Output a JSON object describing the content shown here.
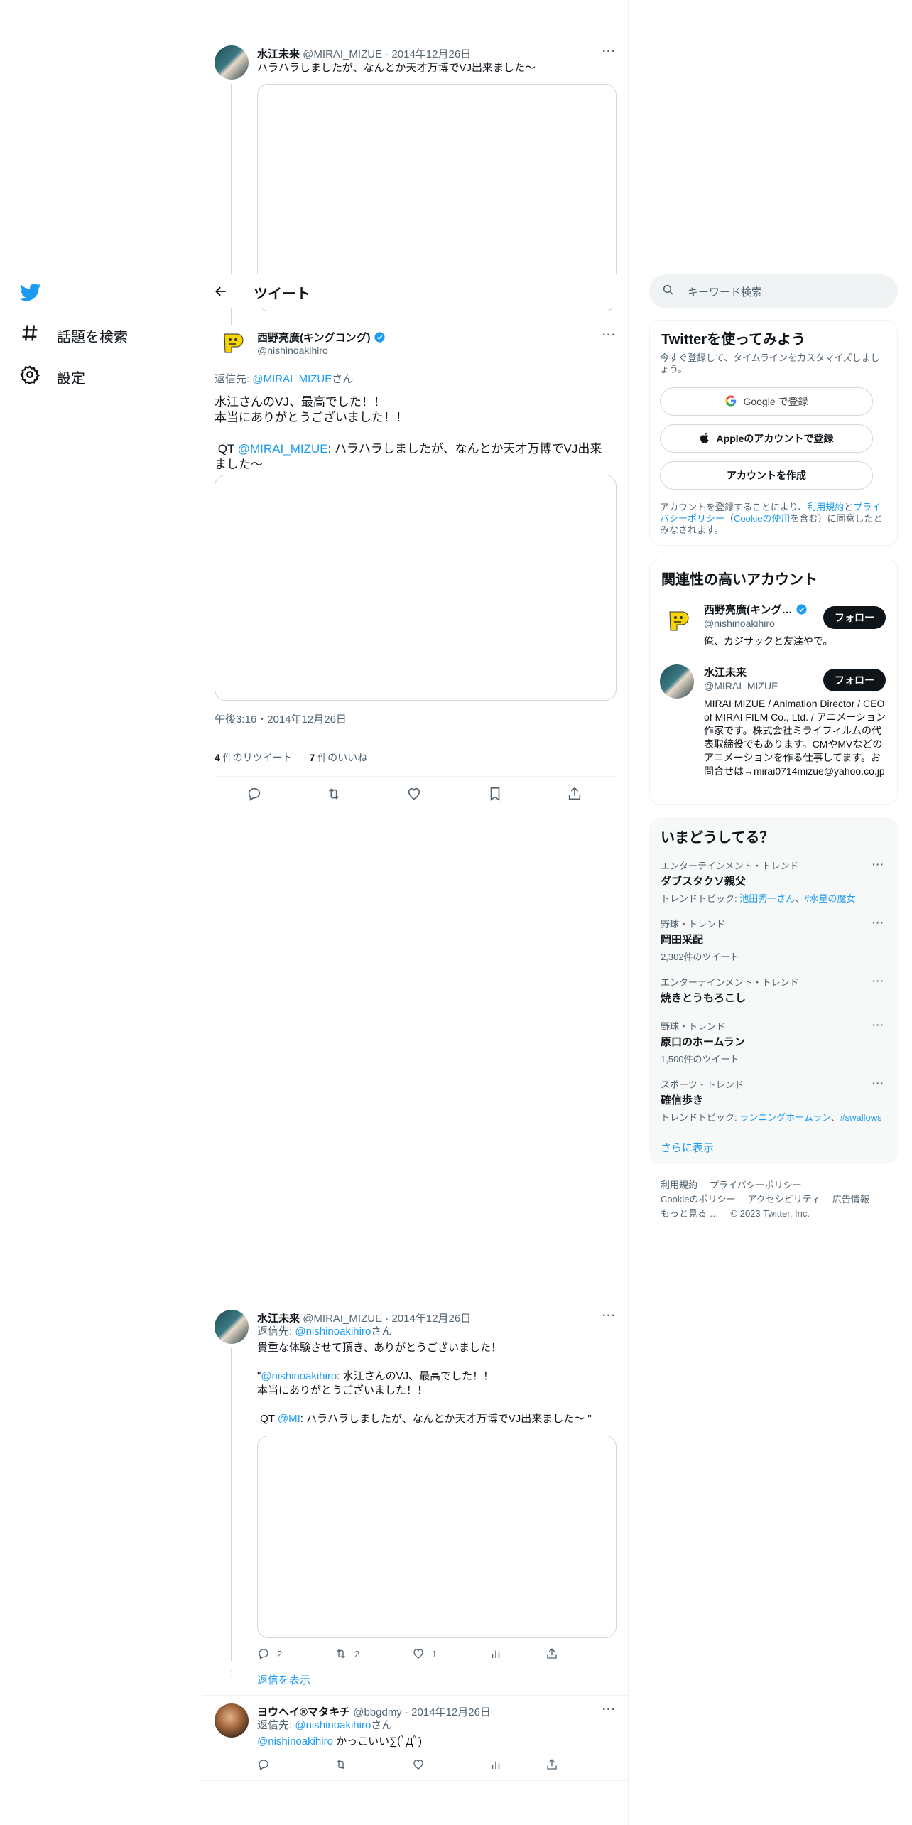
{
  "nav": {
    "items": [
      {
        "label": "話題を検索",
        "icon": "hashtag-icon"
      },
      {
        "label": "設定",
        "icon": "gear-icon"
      }
    ]
  },
  "header": {
    "title": "ツイート"
  },
  "top_tweet": {
    "name": "水江未来",
    "handle": "@MIRAI_MIZUE",
    "date": "2014年12月26日",
    "text": "ハラハラしましたが、なんとか天才万博でVJ出来ました〜"
  },
  "main_tweet": {
    "name": "西野亮廣(キングコング)",
    "handle": "@nishinoakihiro",
    "reply_prefix": "返信先: ",
    "reply_to": "@MIRAI_MIZUE",
    "reply_suffix": "さん",
    "line1": "水江さんのVJ、最高でした！！",
    "line2": "本当にありがとうございました！！",
    "qt_prefix": " QT ",
    "qt_mention": "@MIRAI_MIZUE",
    "qt_text": ": ハラハラしましたが、なんとか天才万博でVJ出来ました〜",
    "timestamp": "午後3:16・2014年12月26日",
    "retweets": "4",
    "retweets_label": " 件のリツイート",
    "likes": "7",
    "likes_label": " 件のいいね"
  },
  "reply1": {
    "name": "水江未来",
    "handle": "@MIRAI_MIZUE",
    "date": "2014年12月26日",
    "reply_prefix": "返信先: ",
    "reply_to": "@nishinoakihiro",
    "reply_suffix": "さん",
    "line1": "貴重な体験させて頂き、ありがとうございました！",
    "quote_open": "\"",
    "quote_mention": "@nishinoakihiro",
    "quote_text": ": 水江さんのVJ、最高でした！！",
    "quote_line2": "本当にありがとうございました！！",
    "qt_prefix": " QT ",
    "qt_mention": "@MI",
    "qt_text": ": ハラハラしましたが、なんとか天才万博でVJ出来ました〜 \"",
    "replies": "2",
    "retweets": "2",
    "likes": "1",
    "show_replies": "返信を表示"
  },
  "reply2": {
    "name": "ヨウヘイ®マタキチ",
    "handle": "@bbgdmy",
    "date": "2014年12月26日",
    "reply_prefix": "返信先: ",
    "reply_to": "@nishinoakihiro",
    "reply_suffix": "さん",
    "mention": "@nishinoakihiro",
    "text": " かっこいい∑(ﾟДﾟ)"
  },
  "search": {
    "placeholder": "キーワード検索"
  },
  "signup": {
    "title": "Twitterを使ってみよう",
    "desc": "今すぐ登録して、タイムラインをカスタマイズしましょう。",
    "google": "Google で登録",
    "apple": "Appleのアカウントで登録",
    "create": "アカウントを作成",
    "legal_1": "アカウントを登録することにより、",
    "terms": "利用規約",
    "legal_2": "と",
    "privacy": "プライバシーポリシー",
    "legal_3": "（",
    "cookie": "Cookieの使用",
    "legal_4": "を含む）に同意したとみなされます。"
  },
  "relevant": {
    "title": "関連性の高いアカウント",
    "follow": "フォロー",
    "accounts": [
      {
        "name": "西野亮廣(キング…",
        "handle": "@nishinoakihiro",
        "bio": "俺、カジサックと友達やで。"
      },
      {
        "name": "水江未来",
        "handle": "@MIRAI_MIZUE",
        "bio": "MIRAI MIZUE / Animation Director / CEO of MIRAI FILM Co., Ltd. / アニメーション作家です。株式会社ミライフィルムの代表取締役でもあります。CMやMVなどのアニメーションを作る仕事してます。お問合せは→mirai0714mizue@yahoo.co.jp"
      }
    ]
  },
  "trends": {
    "title": "いまどうしてる？",
    "items": [
      {
        "meta": "エンターテインメント・トレンド",
        "name": "ダブスタクソ親父",
        "sub_prefix": "トレンドトピック: ",
        "sub_link1": "池田秀一さん",
        "sub_sep": "、",
        "sub_link2": "#水星の魔女"
      },
      {
        "meta": "野球・トレンド",
        "name": "岡田采配",
        "sub": "2,302件のツイート"
      },
      {
        "meta": "エンターテインメント・トレンド",
        "name": "焼きとうもろこし"
      },
      {
        "meta": "野球・トレンド",
        "name": "原口のホームラン",
        "sub": "1,500件のツイート"
      },
      {
        "meta": "スポーツ・トレンド",
        "name": "確信歩き",
        "sub_prefix": "トレンドトピック: ",
        "sub_link1": "ランニングホームラン",
        "sub_sep": "、",
        "sub_link2": "#swallows"
      }
    ],
    "show_more": "さらに表示"
  },
  "footer": {
    "terms": "利用規約",
    "privacy": "プライバシーポリシー",
    "cookie": "Cookieのポリシー",
    "accessibility": "アクセシビリティ",
    "ads": "広告情報",
    "more": "もっと見る …",
    "copyright": "© 2023 Twitter, Inc."
  },
  "colors": {
    "accent": "#1d9bf0",
    "text": "#0f1419",
    "muted": "#536471",
    "verified": "#1d9bf0"
  }
}
